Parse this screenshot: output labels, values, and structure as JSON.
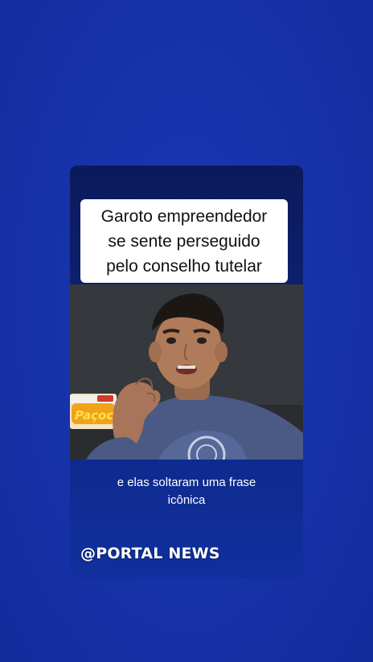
{
  "headline": {
    "text": "Garoto empreendedor\nse sente perseguido\npelo conselho tutelar"
  },
  "video": {
    "description_icon": "boy-speaking-video-frame",
    "package_label": "Paçoca"
  },
  "caption": {
    "text": "e elas soltaram uma frase\nicônica"
  },
  "watermark": {
    "text": "@PORTAL NEWS"
  },
  "colors": {
    "background": "#1632a8",
    "card": "#0d2070",
    "headline_box": "#ffffff"
  }
}
